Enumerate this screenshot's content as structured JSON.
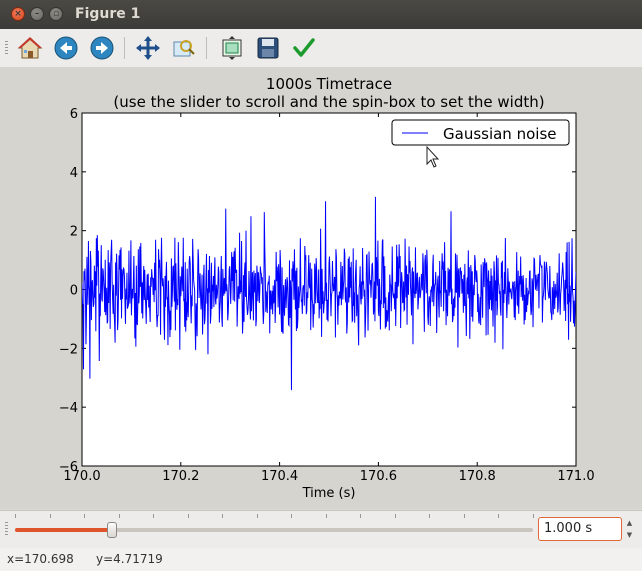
{
  "window": {
    "title": "Figure 1"
  },
  "toolbar": {
    "buttons": [
      "home-icon",
      "back-icon",
      "forward-icon",
      "pan-icon",
      "zoom-icon",
      "subplots-icon",
      "save-icon",
      "edit-icon"
    ]
  },
  "status": {
    "x_text": "x=170.698",
    "y_text": "y=4.71719"
  },
  "controls": {
    "slider_value": 0.1876,
    "spinbox_value": "1.000 s"
  },
  "chart_data": {
    "type": "line",
    "title": "1000s Timetrace",
    "subtitle": "(use the slider to scroll and the spin-box to set the width)",
    "xlabel": "Time (s)",
    "ylabel": "",
    "xlim": [
      170.0,
      171.0
    ],
    "ylim": [
      -6,
      6
    ],
    "xticks": [
      "170.0",
      "170.2",
      "170.4",
      "170.6",
      "170.8",
      "171.0"
    ],
    "yticks": [
      "−6",
      "−4",
      "−2",
      "0",
      "2",
      "4",
      "6"
    ],
    "legend": {
      "location": "upper right",
      "entries": [
        "Gaussian noise"
      ]
    },
    "series": [
      {
        "name": "Gaussian noise",
        "color": "#0000ff",
        "x_start": 170.0,
        "x_step": 0.001,
        "values": [
          0.23,
          -0.49,
          -0.52,
          -2.71,
          0.62,
          0.31,
          0.71,
          -0.16,
          -1.86,
          -0.85,
          1.11,
          0.13,
          -0.52,
          1.65,
          0.14,
          -0.04,
          -3.03,
          1.31,
          0.96,
          -1.04,
          0.19,
          0.32,
          -0.27,
          -0.59,
          -0.48,
          0.81,
          -0.28,
          0.62,
          -1.42,
          1.74,
          0.13,
          1.85,
          0.78,
          1.32,
          -0.04,
          -2.43,
          -0.14,
          -0.91,
          0.51,
          1.51,
          -0.32,
          -0.41,
          0.72,
          0.63,
          0.19,
          -0.14,
          -0.77,
          1.01,
          -0.87,
          -0.41,
          0.06,
          -1.15,
          -1.08,
          1.34,
          -0.46,
          0.92,
          0.63,
          -1.34,
          0.87,
          1.31,
          1.69,
          0.28,
          -0.34,
          -0.83,
          0.16,
          -0.78,
          -1.14,
          -1.81,
          0.92,
          -0.21,
          1.22,
          0.58,
          -1.38,
          -1.04,
          -0.08,
          1.16,
          0.68,
          1.35,
          -0.35,
          1.43,
          -0.98,
          0.69,
          -0.32,
          0.45,
          0.72,
          0.69,
          0.42,
          -0.45,
          -1.17,
          0.03,
          -0.34,
          0.57,
          -0.65,
          -0.58,
          -0.53,
          1.32,
          -0.18,
          -0.48,
          0.31,
          1.67,
          -0.88,
          -0.24,
          0.02,
          -0.3,
          0.29,
          1.14,
          -0.25,
          -1.66,
          -0.12,
          -1.94,
          0.81,
          -1.12,
          -1.21,
          -0.49,
          1.37,
          -0.47,
          -0.15,
          1.46,
          0.09,
          1.58,
          0.28,
          -0.81,
          0.24,
          -0.98,
          0.22,
          0.8,
          -0.36,
          0.67,
          -0.14,
          -0.57,
          -1.17,
          -0.1,
          0.51,
          -0.36,
          0.54,
          -0.61,
          0.13,
          -0.62,
          -1.11,
          0.41,
          0.09,
          0.69,
          0.43,
          0.35,
          -0.18,
          0.39,
          -0.43,
          0.91,
          -0.03,
          1.69,
          0.07,
          -0.83,
          -1.28,
          -0.89,
          -0.89,
          1.37,
          0.74,
          1.01,
          0.36,
          -1.54,
          0.82,
          1.76,
          0.4,
          0.11,
          0.38,
          0.1,
          -1.06,
          -1.71,
          0.46,
          -0.59,
          0.45,
          0.94,
          -0.34,
          -0.26,
          -1.89,
          0.3,
          -0.48,
          -0.83,
          -1.62,
          -0.72,
          -1.37,
          1.06,
          -0.59,
          -0.13,
          0.76,
          0.81,
          0.11,
          -0.41,
          1.76,
          -1.39,
          0.89,
          0.04,
          -0.69,
          -0.33,
          -0.53,
          1.61,
          0.67,
          -0.25,
          -2.05,
          0.45,
          -0.23,
          0.06,
          0.78,
          0.48,
          -0.06,
          1.76,
          -0.36,
          -0.34,
          -1.27,
          0.93,
          -1.43,
          -0.42,
          -1.05,
          0.71,
          -0.69,
          -0.94,
          -0.1,
          0.95,
          1.14,
          0.87,
          -0.48,
          -1.15,
          -0.2,
          -0.57,
          1.72,
          1.03,
          0.32,
          0.13,
          -0.02,
          -1.31,
          -2.06,
          -0.47,
          -0.7,
          -1.59,
          0.3,
          1.37,
          1.07,
          -0.29,
          0.24,
          0.55,
          -0.2,
          -0.68,
          -0.15,
          0.5,
          -1.53,
          -0.88,
          0.43,
          0.84,
          -1.18,
          -0.98,
          -0.35,
          0.36,
          1.21,
          -0.48,
          0.04,
          -2.2,
          0.66,
          -0.11,
          1.14,
          0.14,
          -1.16,
          -0.84,
          0.91,
          -0.66,
          0.16,
          -0.06,
          0.46,
          -0.6,
          0.44,
          1.09,
          -0.36,
          -0.51,
          0.16,
          -0.31,
          -0.15,
          0.13,
          0.78,
          0.59,
          -1.12,
          -0.66,
          -0.4,
          0.43,
          1.14,
          -0.97,
          -1.27,
          0.7,
          0.18,
          -0.21,
          0.39,
          -0.14,
          0.01,
          2.75,
          -0.06,
          0.18,
          -0.07,
          -1.05,
          -0.8,
          -0.18,
          0.69,
          0.79,
          0.15,
          -0.49,
          0.14,
          1.27,
          0.29,
          1.11,
          -0.37,
          1.01,
          1.3,
          -0.41,
          1.42,
          0.57,
          0.62,
          0.67,
          -1.26,
          -0.52,
          0.11,
          -0.15,
          -0.32,
          1.93,
          -0.15,
          0.3,
          -0.09,
          1.65,
          -0.36,
          -1.5,
          -0.97,
          0.49,
          -1.1,
          0.63,
          0.92,
          -0.25,
          2.0,
          -0.27,
          -0.59,
          -0.86,
          -0.72,
          -0.33,
          0.63,
          -0.03,
          -0.66,
          -1.02,
          2.49,
          -0.74,
          -0.25,
          0.59,
          -0.08,
          -1.05,
          0.64,
          -0.1,
          0.34,
          0.56,
          -1.25,
          -1.02,
          0.81,
          0.51,
          -0.4,
          0.59,
          0.3,
          -0.46,
          0.01,
          0.78,
          0.57,
          0.54,
          0.19,
          0.42,
          -0.59,
          -1.17,
          -0.83,
          2.63,
          1.43,
          0.59,
          -0.76,
          -0.06,
          -0.43,
          -0.8,
          0.1,
          0.27,
          0.17,
          0.47,
          -1.49,
          -0.11,
          -0.03,
          -0.68,
          -0.28,
          -0.05,
          -0.84,
          0.14,
          -0.47,
          -0.34,
          0.33,
          -1.14,
          -0.53,
          1.28,
          0.28,
          0.78,
          0.54,
          -0.61,
          0.86,
          0.17,
          -0.85,
          1.34,
          0.87,
          -0.86,
          -1.44,
          0.75,
          -1.42,
          -1.5,
          0.15,
          -0.51,
          -0.89,
          0.02,
          0.35,
          -0.63,
          -0.25,
          0.42,
          0.27,
          -0.29,
          -1.19,
          -1.22,
          0.99,
          -0.97,
          0.31,
          -0.09,
          -3.42,
          0.71,
          0.27,
          0.96,
          0.7,
          -0.35,
          1.37,
          0.28,
          -0.68,
          0.64,
          -1.41,
          0.74,
          -1.32,
          -1.0,
          0.1,
          -0.63,
          -0.25,
          0.02,
          1.74,
          0.02,
          -0.39,
          -0.37,
          -0.83,
          0.03,
          0.13,
          0.12,
          -0.55,
          1.48,
          0.99,
          1.17,
          -0.84,
          -0.75,
          -0.09,
          -0.29,
          0.41,
          1.17,
          0.13,
          0.04,
          0.91,
          -1.38,
          -0.15,
          0.71,
          -0.34,
          -0.48,
          -1.29,
          -0.5,
          -0.84,
          0.88,
          0.56,
          -0.47,
          1.07,
          0.66,
          -0.08,
          -0.44,
          -0.44,
          0.68,
          -0.98,
          -0.41,
          -0.66,
          2.07,
          0.44,
          -1.61,
          0.7,
          -0.49,
          -0.06,
          -0.81,
          -0.53,
          -0.32,
          0.14,
          3.0,
          -0.39,
          0.23,
          -1.03,
          -0.35,
          -1.09,
          -0.21,
          0.91,
          1.12,
          0.46,
          -0.11,
          -0.91,
          -0.19,
          -0.1,
          0.97,
          0.24,
          -0.04,
          -0.03,
          0.43,
          0.38,
          -1.63,
          1.37,
          1.09,
          -0.03,
          -0.32,
          -1.2,
          -0.2,
          -0.55,
          -0.07,
          -0.25,
          -0.3,
          0.94,
          -0.53,
          0.14,
          0.8,
          -0.34,
          0.07,
          0.3,
          1.39,
          1.21,
          -0.32,
          -0.44,
          0.07,
          -1.5,
          -1.15,
          0.02,
          1.05,
          -0.44,
          1.12,
          -0.27,
          0.76,
          0.06,
          0.94,
          -0.41,
          -1.08,
          -1.05,
          1.4,
          -0.56,
          -0.1,
          -1.13,
          0.18,
          0.67,
          1.01,
          -0.91,
          -0.23,
          -0.2,
          -1.19,
          -1.9,
          0.06,
          0.17,
          0.79,
          -0.29,
          -0.51,
          0.27,
          -0.32,
          1.41,
          0.21,
          0.24,
          -0.24,
          -0.01,
          -1.63,
          -1.01,
          -0.25,
          1.16,
          1.18,
          0.04,
          -1.4,
          -0.23,
          1.29,
          0.57,
          0.17,
          0.32,
          -0.28,
          0.23,
          0.86,
          0.88,
          0.32,
          -0.85,
          -0.66,
          0.27,
          -1.08,
          3.15,
          -0.32,
          1.1,
          0.68,
          0.13,
          1.66,
          -0.73,
          -0.9,
          0.36,
          -0.02,
          -1.36,
          -0.36,
          -0.5,
          0.78,
          1.66,
          1.7,
          -0.63,
          1.12,
          -0.47,
          0.8,
          -1.33,
          -0.27,
          -1.27,
          -0.7,
          -0.89,
          -1.09,
          -0.36,
          -0.09,
          -1.39,
          0.51,
          0.17,
          0.15,
          -0.74,
          -0.14,
          1.46,
          0.03,
          -0.19,
          -0.29,
          -0.14,
          -0.67,
          0.26,
          -1.24,
          -0.25,
          1.52,
          -0.3,
          1.12,
          0.1,
          0.26,
          1.54,
          0.72,
          1.14,
          -1.31,
          -0.04,
          0.59,
          0.3,
          -0.46,
          -0.42,
          0.27,
          -0.71,
          -0.68,
          1.73,
          0.44,
          -0.27,
          0.81,
          -1.2,
          0.52,
          0.14,
          -0.18,
          1.46,
          0.57,
          0.97,
          0.13,
          -0.24,
          -0.88,
          0.56,
          0.75,
          -1.86,
          0.61,
          -0.12,
          -0.07,
          -0.29,
          1.43,
          -0.15,
          -0.02,
          0.53,
          0.57,
          -0.68,
          -0.41,
          0.21,
          0.43,
          -0.29,
          -0.24,
          -0.02,
          0.53,
          0.21,
          -0.03,
          1.23,
          0.82,
          -0.32,
          -1.44,
          0.95,
          1.17,
          0.48,
          -0.13,
          1.35,
          0.87,
          -0.9,
          -1.2,
          -0.45,
          -0.23,
          -0.37,
          -1.24,
          -0.01,
          -0.07,
          0.11,
          -0.43,
          0.81,
          1.18,
          -0.57,
          -0.08,
          0.17,
          0.19,
          0.6,
          0.04,
          -1.48,
          -0.25,
          0.32,
          0.47,
          -0.5,
          -0.95,
          0.97,
          -0.12,
          -0.04,
          -0.59,
          0.53,
          1.23,
          0.68,
          0.95,
          -0.74,
          0.45,
          1.61,
          -0.11,
          0.63,
          -1.21,
          -0.01,
          -0.49,
          -0.91,
          0.74,
          0.54,
          -0.21,
          0.69,
          -0.1,
          0.13,
          2.66,
          -0.5,
          0.03,
          -1.11,
          -0.99,
          -0.31,
          -0.9,
          -0.24,
          -0.62,
          1.23,
          -0.07,
          -0.11,
          1.18,
          0.48,
          -1.97,
          0.63,
          0.72,
          -0.27,
          0.04,
          0.75,
          0.52,
          0.63,
          -0.14,
          0.36,
          0.21,
          -0.79,
          0.5,
          -0.56,
          0.87,
          -0.35,
          -0.68,
          -1.58,
          0.25,
          0.41,
          -0.16,
          1.33,
          -0.3,
          0.76,
          -1.68,
          -0.47,
          0.83,
          0.55,
          -0.93,
          0.62,
          -1.09,
          -0.32,
          0.16,
          -0.19,
          1.17,
          0.99,
          0.38,
          0.25,
          0.65,
          0.31,
          -0.77,
          -0.15,
          -1.06,
          -1.16,
          -0.63,
          -0.25,
          -1.21,
          0.85,
          0.09,
          -0.27,
          -0.96,
          0.93,
          0.65,
          0.08,
          1.06,
          0.9,
          0.85,
          -1.56,
          0.92,
          0.47,
          0.27,
          -1.54,
          0.65,
          -0.12,
          -0.67,
          0.29,
          -0.35,
          0.72,
          -0.71,
          0.47,
          -0.18,
          -1.26,
          -0.15,
          0.96,
          0.57,
          -1.81,
          0.31,
          -0.39,
          1.16,
          -0.88,
          -0.59,
          1.08,
          0.19,
          0.18,
          -0.15,
          -0.05,
          -0.66,
          -0.89,
          0.92,
          0.39,
          0.98,
          -2.03,
          -0.01,
          -0.46,
          0.59,
          -0.15,
          1.75,
          0.17,
          -0.3,
          -0.97,
          -0.37,
          0.72,
          0.21,
          -0.51,
          0.27,
          -0.1,
          -0.01,
          0.01,
          -0.24,
          -0.33,
          -0.01,
          0.25,
          0.24,
          -0.24,
          -0.95,
          0.28,
          -1.04,
          -0.05,
          0.14,
          1.27,
          -0.51,
          -0.54,
          0.64,
          -0.83,
          -0.07,
          0.46,
          0.17,
          1.12,
          -0.26,
          0.46,
          0.19,
          -0.38,
          0.49,
          0.13,
          -1.19,
          -0.18,
          -1.04,
          -0.61,
          0.39,
          -0.77,
          0.06,
          -0.53,
          -0.27,
          -0.08,
          -0.11,
          0.62,
          0.63,
          -0.47,
          -0.87,
          -0.7,
          0.38,
          0.26,
          -1.28,
          0.02,
          1.06,
          1.04,
          0.41,
          -0.01,
          0.5,
          0.26,
          -0.05,
          0.28,
          0.51,
          0.52,
          -0.64,
          0.57,
          1.17,
          0.88,
          0.83,
          0.76,
          0.78,
          -1.12,
          -0.33,
          -0.2,
          0.06,
          0.95,
          0.29,
          -0.36,
          0.7,
          0.94,
          0.72,
          0.52,
          0.03,
          -0.13,
          -0.29,
          -0.28,
          0.8,
          -0.01,
          -0.77,
          -0.81,
          -1.04,
          0.08,
          -0.18,
          -0.85,
          0.29,
          -0.24,
          -0.66,
          0.19,
          -0.28,
          -0.23,
          -0.02,
          0.57,
          -0.78,
          -0.61,
          0.22,
          1.23,
          -0.35,
          -0.86,
          -0.15,
          0.03,
          0.39,
          0.57,
          0.92,
          0.64,
          0.2,
          -0.73,
          -0.15,
          0.33,
          -1.07,
          1.27,
          0.03,
          1.6,
          -0.5,
          -0.14,
          -1.71,
          1.62,
          -0.43,
          0.13,
          -1.1,
          -0.4,
          0.3,
          1.74,
          -0.06,
          -0.26,
          -1.15,
          -0.38,
          -1.26,
          -0.72,
          0.03,
          0.61,
          -0.09,
          0.23,
          0.13,
          0.76,
          0.44,
          -0.56,
          0.27,
          0.46,
          1.09,
          0.24,
          0.14,
          0.25,
          0.34,
          -0.48,
          -0.02,
          -0.42,
          -0.67,
          -0.48,
          2.14,
          -0.68,
          -0.37,
          -0.21,
          0.43,
          -1.28,
          -1.01,
          -0.11,
          -0.57,
          -0.64,
          -0.31,
          -1.74,
          0.26,
          -1.31,
          0.17,
          -0.05,
          -0.35,
          -0.23,
          -0.12,
          -0.65,
          2.47,
          -0.05
        ]
      }
    ]
  }
}
